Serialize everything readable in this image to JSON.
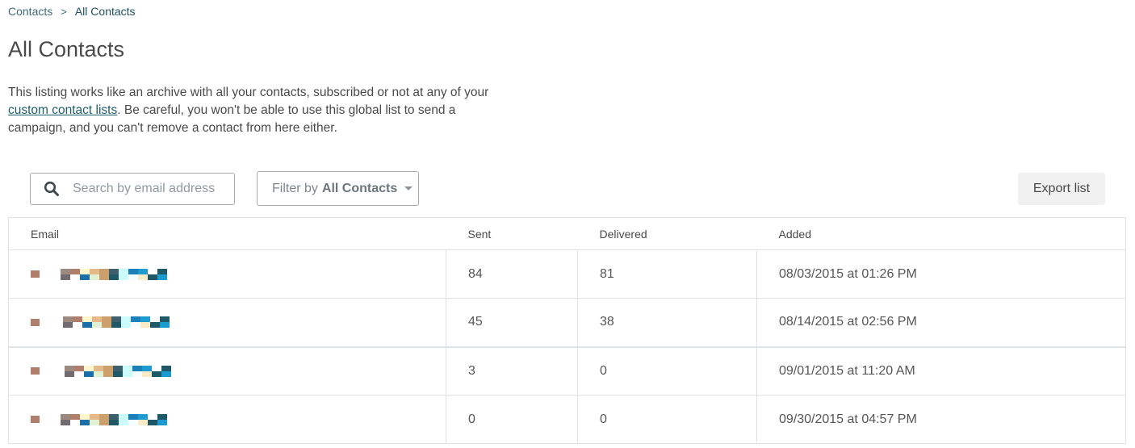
{
  "breadcrumb": {
    "parent": "Contacts",
    "separator": ">",
    "current": "All Contacts"
  },
  "page": {
    "title": "All Contacts",
    "description_before": "This listing works like an archive with all your contacts, subscribed or not at any of your ",
    "description_link": "custom contact lists",
    "description_after": ". Be careful, you won't be able to use this global list to send a campaign, and you can't remove a contact from here either."
  },
  "toolbar": {
    "search_placeholder": "Search by email address",
    "search_value": "",
    "search_icon": "search-icon",
    "filter_prefix": "Filter by",
    "filter_value": "All Contacts",
    "filter_icon": "caret-down-icon",
    "export_label": "Export list"
  },
  "table": {
    "columns": [
      "Email",
      "Sent",
      "Delivered",
      "Added"
    ],
    "rows": [
      {
        "email": "[redacted]",
        "sent": "84",
        "delivered": "81",
        "added": "08/03/2015 at 01:26 PM"
      },
      {
        "email": "[redacted]",
        "sent": "45",
        "delivered": "38",
        "added": "08/14/2015 at 02:56 PM"
      },
      {
        "email": "[redacted]",
        "sent": "3",
        "delivered": "0",
        "added": "09/01/2015 at 11:20 AM"
      },
      {
        "email": "[redacted]",
        "sent": "0",
        "delivered": "0",
        "added": "09/30/2015 at 04:57 PM"
      }
    ]
  },
  "colors": {
    "link": "#1f5d6b",
    "border": "#e2e2e2",
    "export_bg": "#f1f1f1",
    "text": "#4a4a4a"
  }
}
